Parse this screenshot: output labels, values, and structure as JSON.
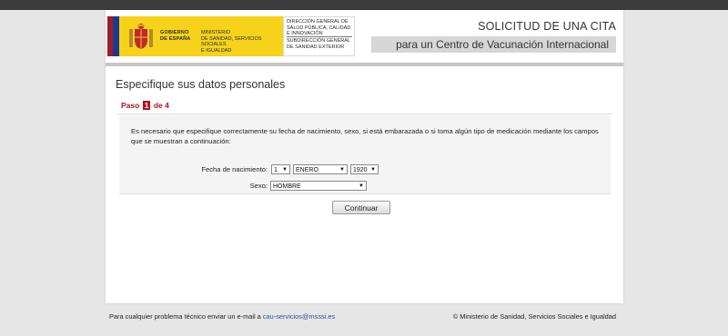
{
  "header": {
    "gobierno": "GOBIERNO\nDE ESPAÑA",
    "ministerio": "MINISTERIO\nDE SANIDAD, SERVICIOS SOCIALES\nE IGUALDAD",
    "direccion": "DIRECCIÓN GENERAL DE\nSALUD PÚBLICA, CALIDAD\nE INNOVACIÓN",
    "subdireccion": "SUBDIRECCIÓN GENERAL\nDE SANIDAD EXTERIOR",
    "title_line1": "SOLICITUD DE UNA CITA",
    "title_line2": "para un Centro de Vacunación Internacional"
  },
  "colors": {
    "accent_red": "#b0131d",
    "logo_yellow": "#f6d21a"
  },
  "main": {
    "section_title": "Especifique sus datos personales",
    "step": {
      "prefix": "Paso",
      "current": "1",
      "suffix": "de 4"
    },
    "intro": "Es necesario que especifique correctamente su fecha de nacimiento, sexo, si está embarazada o si toma algún tipo de medicación mediante los campos que se muestran a continuación:",
    "birth": {
      "label": "Fecha de nacimiento:",
      "day": "1",
      "month": "ENERO",
      "year": "1920"
    },
    "sex": {
      "label": "Sexo:",
      "value": "HOMBRE"
    },
    "continue_label": "Continuar"
  },
  "footer": {
    "left_text": "Para cualquier problema técnico enviar un e-mail a",
    "email": "cau-servicios@msssi.es",
    "right_text": "© Ministerio de Sanidad, Servicios Sociales e Igualdad"
  },
  "icons": {
    "dropdown": "triangle-down",
    "coat_of_arms": "spain-coat-of-arms"
  }
}
